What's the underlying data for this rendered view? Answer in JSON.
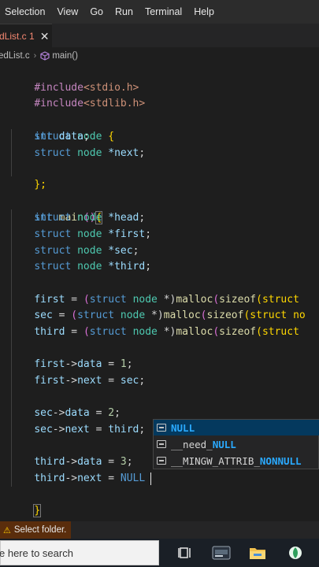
{
  "menu": [
    "Selection",
    "View",
    "Go",
    "Run",
    "Terminal",
    "Help"
  ],
  "tab": {
    "label": "dList.c 1",
    "close": "✕"
  },
  "breadcrumb": {
    "file": "edList.c",
    "separator": "›",
    "symbol": "main()"
  },
  "code": {
    "l1_directive": "#include",
    "l1_header": "<stdio.h>",
    "l2_directive": "#include",
    "l2_header": "<stdlib.h>",
    "struct_kw": "struct",
    "node_name": "node",
    "open_brace": "{",
    "int_kw": "int",
    "data_field": "data",
    "semi": ";",
    "next_field": "*next",
    "close_brace": "};",
    "main_fn": "main",
    "open_paren": "(",
    "close_paren": ")",
    "head_var": "*head",
    "first_var": "*first",
    "sec_var": "*sec",
    "third_var": "*third",
    "first": "first",
    "sec": "sec",
    "third": "third",
    "eq": " = ",
    "cast_open": "(",
    "cast_ptr": " *)",
    "malloc": "malloc",
    "sizeof": "sizeof",
    "sizeof_struct_tail": "(struct",
    "sizeof_struct_tail2": "(struct no",
    "arrow": "->",
    "data": "data",
    "next": "next",
    "one": "1",
    "two": "2",
    "three": "3",
    "null_typed": "NULL",
    "final_brace": "}"
  },
  "suggestions": [
    {
      "prefix": "",
      "match": "NULL",
      "suffix": ""
    },
    {
      "prefix": "__need_",
      "match": "NULL",
      "suffix": ""
    },
    {
      "prefix": "__MINGW_ATTRIB_",
      "match": "NON",
      "suffix": "NULL"
    }
  ],
  "status": {
    "warning": "Select folder."
  },
  "taskbar": {
    "search_placeholder": "e here to search"
  },
  "colors": {
    "keyword": "#569cd6",
    "type": "#4ec9b0",
    "function": "#dcdcaa",
    "variable": "#9cdcfe",
    "number": "#b5cea8",
    "string": "#ce9178",
    "error_tab": "#f48771"
  }
}
